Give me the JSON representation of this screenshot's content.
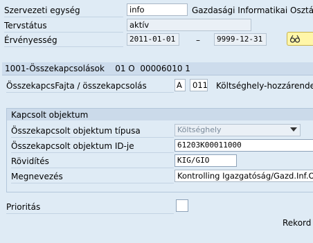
{
  "header": {
    "org_unit_label": "Szervezeti egység",
    "org_unit_value": "info",
    "org_unit_name": "Gazdasági Informatikai Osztály",
    "plan_status_label": "Tervstátus",
    "plan_status_value": "aktív",
    "validity_label": "Érvényesség",
    "validity_from": "2011-01-01",
    "validity_sep": "–",
    "validity_to": "9999-12-31"
  },
  "relationship": {
    "title": "1001-Összekapcsolások    01 O  00006010 1",
    "type_label": "ÖsszekapcsFajta / összekapcsolás",
    "type_code": "A",
    "rel_code": "011",
    "rel_text": "Költséghely-hozzárendelés"
  },
  "linked_object": {
    "group_title": "Kapcsolt objektum",
    "type_label": "Összekapcsolt objektum típusa",
    "type_value": "Költséghely",
    "id_label": "Összekapcsolt objektum ID-je",
    "id_value": "61203K00011000",
    "abbr_label": "Rövidítés",
    "abbr_value": "KIG/GIO",
    "name_label": "Megnevezés",
    "name_value": "Kontrolling Igazgatóság/Gazd.Inf.O."
  },
  "footer": {
    "priority_label": "Prioritás",
    "record_label": "Rekord"
  },
  "icons": {
    "validity_button": "period-glasses-icon",
    "dropdown": "chevron-down-icon"
  },
  "colors": {
    "background": "#dfebf5",
    "accent_button": "#fff6a8"
  }
}
